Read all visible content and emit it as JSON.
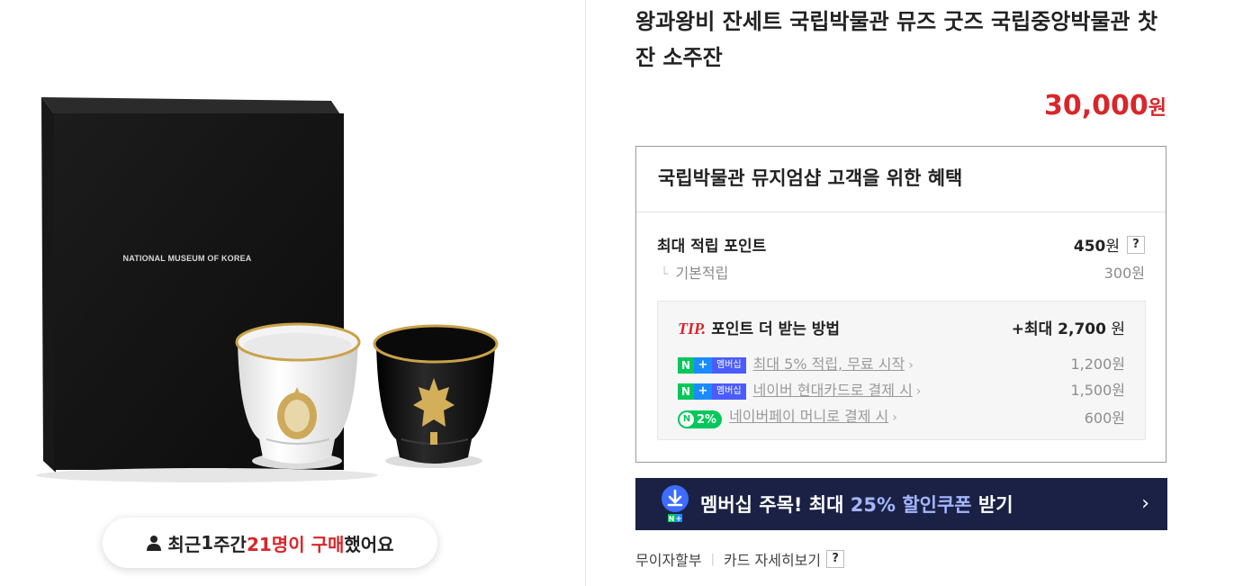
{
  "product": {
    "title": "왕과왕비 잔세트 국립박물관 뮤즈 굿즈 국립중앙박물관 찻잔 소주잔",
    "price": "30,000",
    "price_unit": "원",
    "box_brand": "NATIONAL MUSEUM OF KOREA"
  },
  "buyers": {
    "prefix": "최근 ",
    "num1": "1",
    "mid": "주간 ",
    "count": "21명이 구매",
    "suffix": " 했어요"
  },
  "benefit": {
    "heading": "국립박물관 뮤지엄샵 고객을 위한 혜택",
    "max_label": "최대 적립 포인트",
    "max_value": "450",
    "max_unit": "원",
    "help": "?",
    "basic_lead": "└",
    "basic_label": "기본적립",
    "basic_value": "300원",
    "tip": {
      "tip_word": "TIP.",
      "label": "포인트 더 받는 방법",
      "max_prefix": "+최대 ",
      "max_value": "2,700",
      "max_unit": " 원",
      "items": [
        {
          "badge_n": "N",
          "badge_plus": "+",
          "badge_text": "멤버십",
          "text": "최대 5% 적립, 무료 시작",
          "value": "1,200원"
        },
        {
          "badge_n": "N",
          "badge_plus": "+",
          "badge_text": "멤버십",
          "text": "네이버 현대카드로 결제 시",
          "value": "1,500원"
        },
        {
          "badge_pay": "2%",
          "text": "네이버페이 머니로 결제 시",
          "value": "600원"
        }
      ],
      "chev": "›"
    }
  },
  "member_banner": {
    "part1": "멤버십 주목! 최대 ",
    "highlight": "25% 할인쿠폰",
    "part2": " 받기",
    "arrow": "›",
    "icon_n": "N",
    "icon_plus": "+"
  },
  "footer": {
    "installment": "무이자할부",
    "card_detail": "카드 자세히보기",
    "help": "?"
  },
  "colors": {
    "price_red": "#d8262b",
    "banner_navy": "#1a2144",
    "naver_green": "#03c75a"
  },
  "icons": [
    "person-icon",
    "download-icon",
    "help-icon",
    "chevron-right-icon"
  ]
}
